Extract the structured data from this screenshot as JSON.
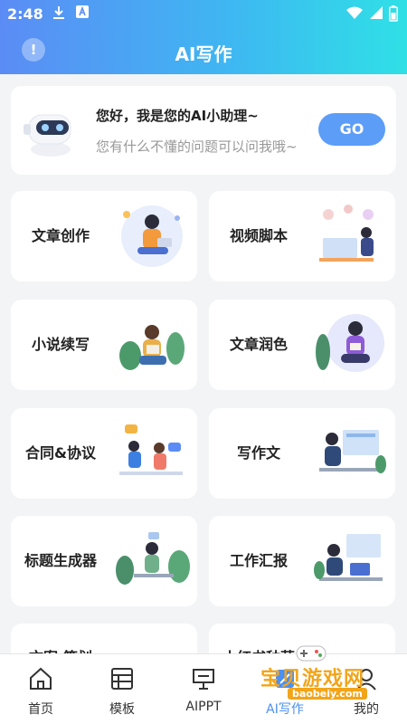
{
  "status": {
    "time": "2:48"
  },
  "header": {
    "title": "AI写作",
    "info_icon": "info-icon"
  },
  "assistant": {
    "greeting": "您好，我是您的AI小助理~",
    "subtitle": "您有什么不懂的问题可以问我哦~",
    "button": "GO"
  },
  "cards": [
    {
      "label": "文章创作"
    },
    {
      "label": "视频脚本"
    },
    {
      "label": "小说续写"
    },
    {
      "label": "文章润色"
    },
    {
      "label": "合同&协议"
    },
    {
      "label": "写作文"
    },
    {
      "label": "标题生成器"
    },
    {
      "label": "工作汇报"
    },
    {
      "label": "文案·策划"
    },
    {
      "label": "小红书种草"
    }
  ],
  "nav": [
    {
      "label": "首页",
      "icon": "home-icon"
    },
    {
      "label": "模板",
      "icon": "template-icon"
    },
    {
      "label": "AIPPT",
      "icon": "ppt-icon"
    },
    {
      "label": "AI写作",
      "icon": "write-icon",
      "active": true
    },
    {
      "label": "我的",
      "icon": "profile-icon"
    }
  ],
  "watermark": {
    "text": "宝贝游戏网",
    "url": "baobeiy.com"
  },
  "colors": {
    "accent": "#5b9df7",
    "header_start": "#5b8cf5",
    "header_end": "#2fe0e6",
    "watermark": "#f2a51a"
  }
}
